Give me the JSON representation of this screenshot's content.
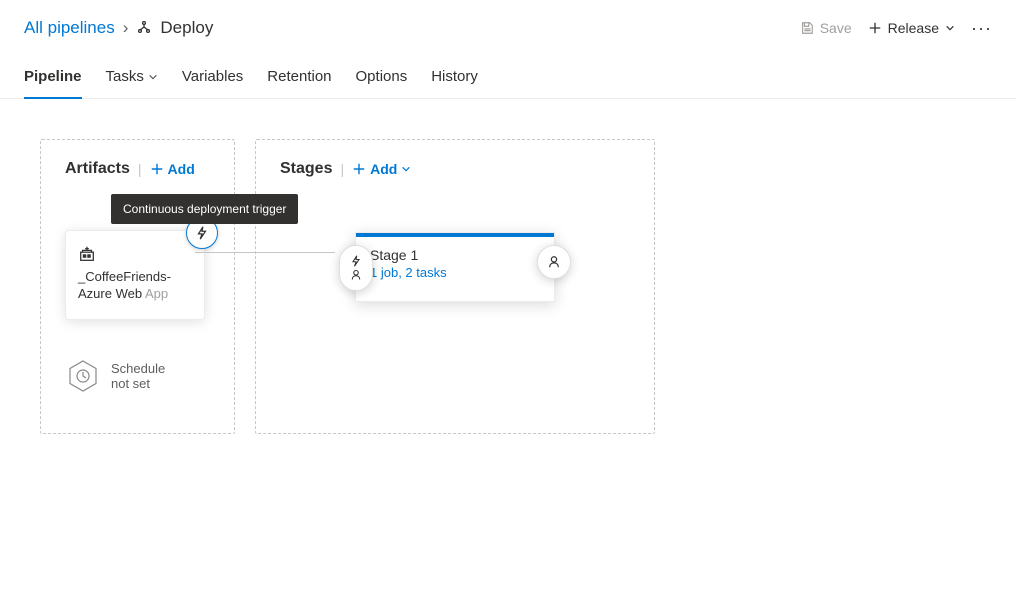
{
  "breadcrumb": {
    "root": "All pipelines",
    "current": "Deploy"
  },
  "header_actions": {
    "save": "Save",
    "release": "Release"
  },
  "tabs": [
    {
      "label": "Pipeline",
      "active": true
    },
    {
      "label": "Tasks",
      "dropdown": true
    },
    {
      "label": "Variables"
    },
    {
      "label": "Retention"
    },
    {
      "label": "Options"
    },
    {
      "label": "History"
    }
  ],
  "artifacts": {
    "title": "Artifacts",
    "add_label": "Add",
    "trigger_tooltip": "Continuous deployment trigger",
    "card": {
      "name_line1": "_CoffeeFriends-",
      "name_line2_strong": "Azure Web",
      "name_line2_faded": " App"
    },
    "schedule": {
      "line1": "Schedule",
      "line2": "not set"
    }
  },
  "stages": {
    "title": "Stages",
    "add_label": "Add",
    "card": {
      "name": "Stage 1",
      "detail": "1 job, 2 tasks"
    }
  }
}
